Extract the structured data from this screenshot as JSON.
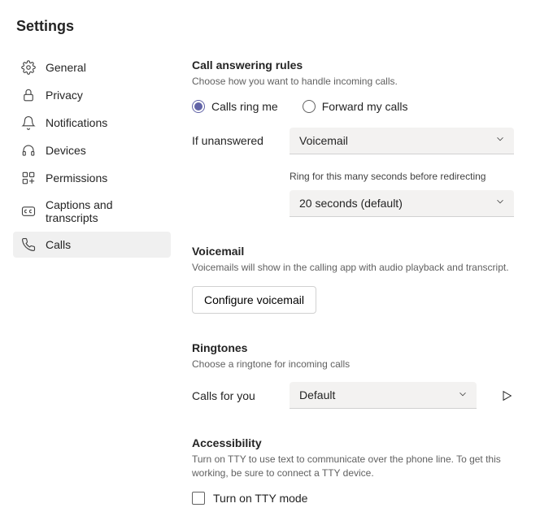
{
  "page": {
    "title": "Settings"
  },
  "sidebar": {
    "items": [
      {
        "label": "General"
      },
      {
        "label": "Privacy"
      },
      {
        "label": "Notifications"
      },
      {
        "label": "Devices"
      },
      {
        "label": "Permissions"
      },
      {
        "label": "Captions and transcripts"
      },
      {
        "label": "Calls"
      }
    ]
  },
  "callRules": {
    "heading": "Call answering rules",
    "description": "Choose how you want to handle incoming calls.",
    "radio1": "Calls ring me",
    "radio2": "Forward my calls",
    "ifUnansweredLabel": "If unanswered",
    "ifUnansweredValue": "Voicemail",
    "ringForLabel": "Ring for this many seconds before redirecting",
    "ringForValue": "20 seconds (default)"
  },
  "voicemail": {
    "heading": "Voicemail",
    "description": "Voicemails will show in the calling app with audio playback and transcript.",
    "buttonLabel": "Configure voicemail"
  },
  "ringtones": {
    "heading": "Ringtones",
    "description": "Choose a ringtone for incoming calls",
    "callsForYouLabel": "Calls for you",
    "callsForYouValue": "Default"
  },
  "accessibility": {
    "heading": "Accessibility",
    "description": "Turn on TTY to use text to communicate over the phone line. To get this working, be sure to connect a TTY device.",
    "checkboxLabel": "Turn on TTY mode"
  }
}
